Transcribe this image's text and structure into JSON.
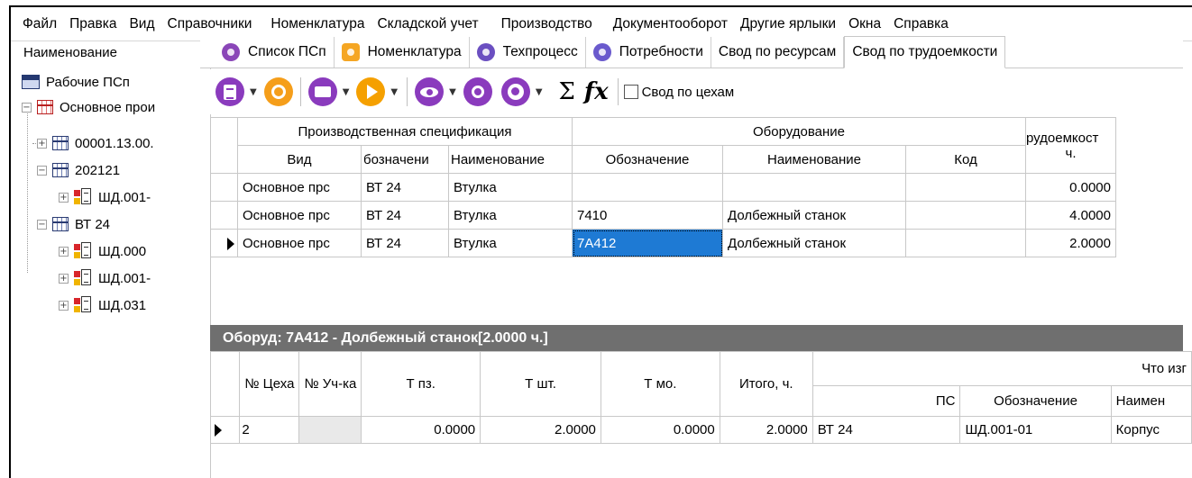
{
  "menu": [
    "Файл",
    "Правка",
    "Вид",
    "Справочники",
    "Номенклатура",
    "Складской учет",
    "Производство",
    "Документооборот",
    "Другие ярлыки",
    "Окна",
    "Справка"
  ],
  "tree": {
    "header": "Наименование",
    "root": "Рабочие ПСп",
    "group": "Основное прои",
    "nodes": [
      "00001.13.00.",
      "202121",
      "ШД.001-",
      "ВТ 24",
      "ШД.000",
      "ШД.001-",
      "ШД.031"
    ]
  },
  "tabs": [
    "Список ПСп",
    "Номенклатура",
    "Техпроцесс",
    "Потребности",
    "Свод по ресурсам",
    "Свод по трудоемкости"
  ],
  "toolbar": {
    "checkbox_label": "Свод по цехам",
    "sigma": "Σ",
    "fx": "fx",
    "icons": [
      "document-icon",
      "refresh-icon",
      "print-icon",
      "play-icon",
      "view-icon",
      "zoom-icon",
      "globe-icon"
    ]
  },
  "grid1": {
    "group_headers": [
      "Производственная спецификация",
      "Оборудование",
      "рудоемкост"
    ],
    "headers": [
      "Вид",
      "бозначени",
      "Наименование",
      "Обозначение",
      "Наименование",
      "Код",
      "ч."
    ],
    "rows": [
      [
        "Основное прс",
        "ВТ 24",
        "Втулка",
        "",
        "",
        "",
        "0.0000"
      ],
      [
        "Основное прс",
        "ВТ 24",
        "Втулка",
        "7410",
        "Долбежный станок",
        "",
        "4.0000"
      ],
      [
        "Основное прс",
        "ВТ 24",
        "Втулка",
        "7А412",
        "Долбежный станок",
        "",
        "2.0000"
      ]
    ]
  },
  "detail": {
    "title": "Оборуд: 7А412 - Долбежный станок[2.0000 ч.]",
    "headers": [
      "№ Цеха",
      "№ Уч-ка",
      "Т пз.",
      "Т шт.",
      "Т мо.",
      "Итого, ч.",
      "Что изг",
      "ПС",
      "Обозначение",
      "Наимен"
    ],
    "rows": [
      [
        "2",
        "",
        "0.0000",
        "2.0000",
        "0.0000",
        "2.0000",
        "ВТ 24",
        "ШД.001-01",
        "Корпус"
      ]
    ]
  },
  "colors": {
    "selection": "#1e7ad4",
    "panel_header": "#6f6f6f",
    "accent_purple": "#8a3bbd",
    "accent_orange": "#f59e1a"
  }
}
